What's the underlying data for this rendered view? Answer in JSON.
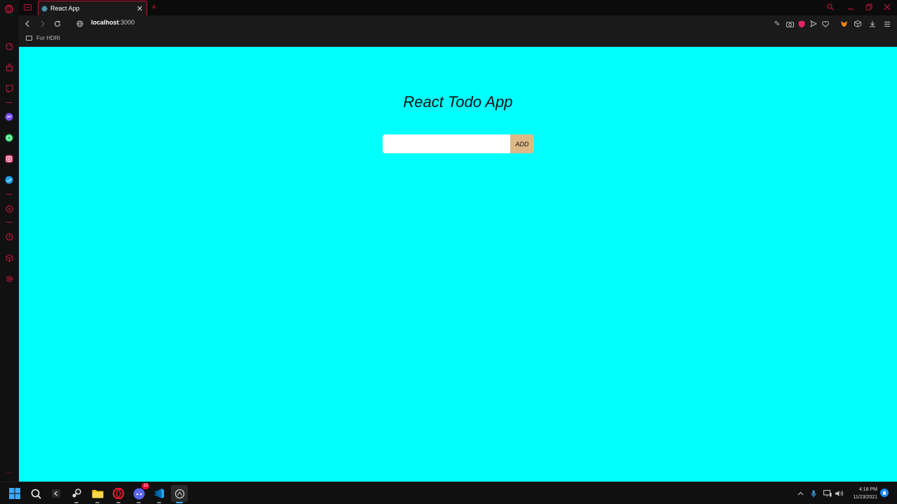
{
  "browser": {
    "tab": {
      "title": "React App"
    },
    "address": {
      "host": "localhost",
      "port": ":3000"
    },
    "bookmarks": [
      {
        "label": "For HDRI"
      }
    ]
  },
  "app": {
    "title": "React Todo App",
    "input": {
      "value": "",
      "placeholder": ""
    },
    "add_label": "ADD"
  },
  "taskbar": {
    "clock": {
      "time": "4:18 PM",
      "date": "11/23/2021"
    },
    "discord_badge": "10"
  },
  "colors": {
    "accent": "#c0163a",
    "page_background": "#00ffff",
    "add_button": "#deb887"
  }
}
